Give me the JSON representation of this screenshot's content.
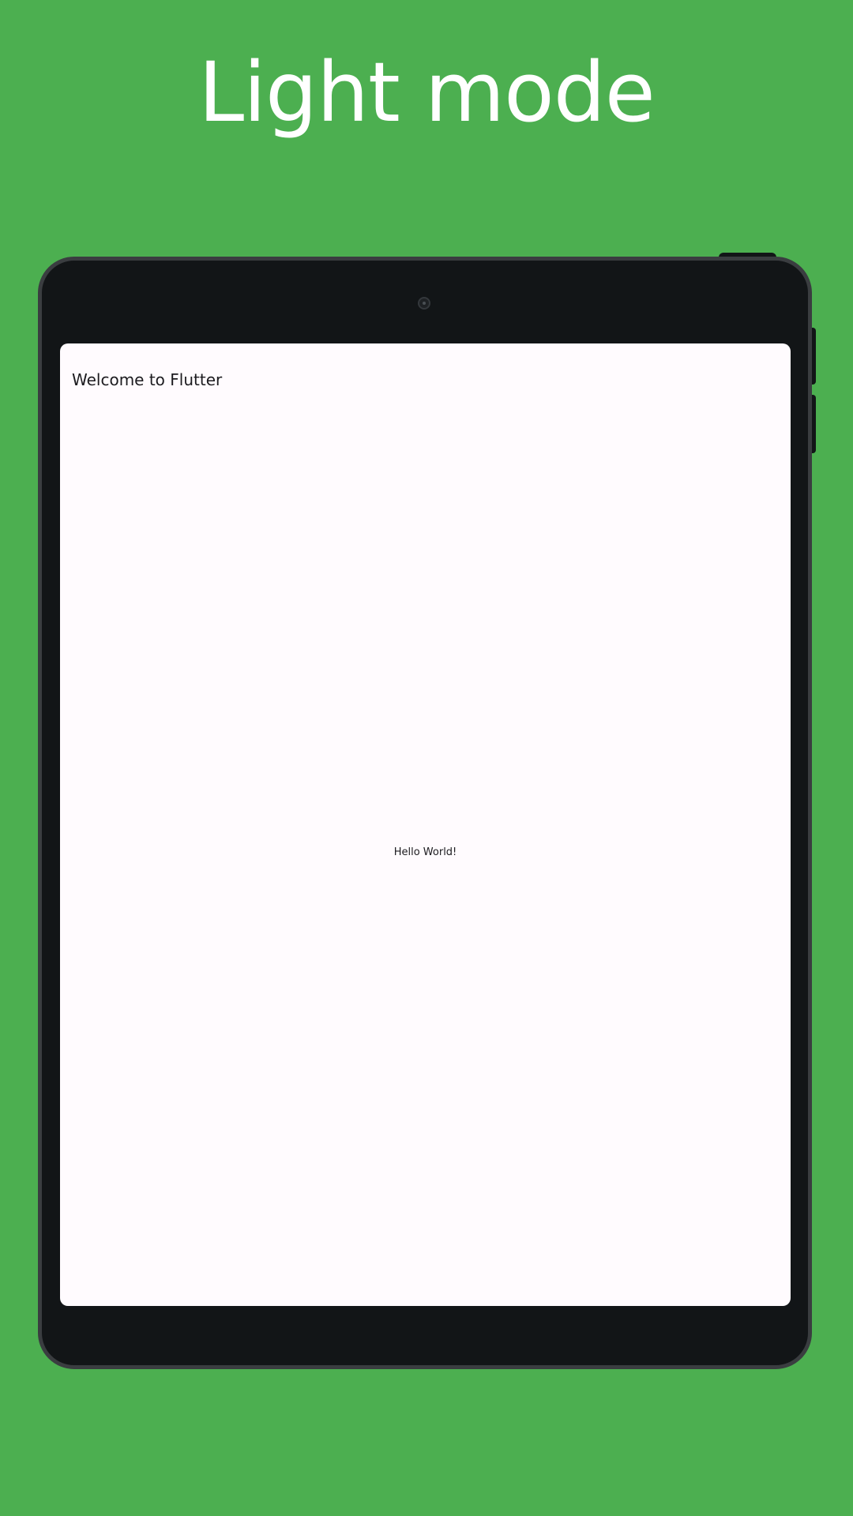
{
  "headline": "Light mode",
  "app": {
    "title": "Welcome to Flutter",
    "body_text": "Hello World!"
  },
  "colors": {
    "background": "#4caf50",
    "device_frame": "#121517",
    "device_bezel": "#3a3d40",
    "screen": "#fffbfe",
    "text": "#1c1b1f"
  }
}
